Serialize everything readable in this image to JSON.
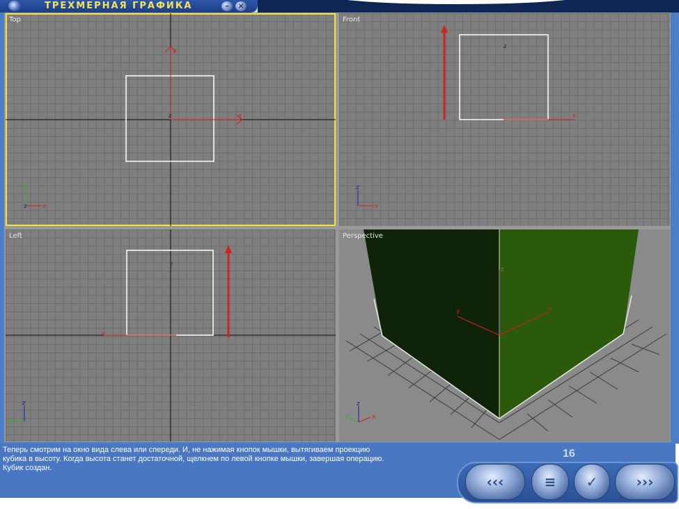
{
  "window": {
    "title": "ТРЕХМЕРНАЯ ГРАФИКА",
    "minimize_symbol": "–",
    "close_symbol": "×"
  },
  "viewports": {
    "top": {
      "label": "Top"
    },
    "front": {
      "label": "Front"
    },
    "left": {
      "label": "Left"
    },
    "perspective": {
      "label": "Perspective"
    }
  },
  "axes": {
    "x": "x",
    "y": "y",
    "z": "z"
  },
  "info": {
    "lines": [
      "Теперь смотрим на окно вида слева или спереди. И, не нажимая кнопок мышки, вытягиваем проекцию",
      "кубика в высоту. Когда высота станет достаточной, щелкнем по левой кнопке мышки, завершая операцию.",
      "Кубик создан."
    ]
  },
  "page": {
    "number": "16"
  },
  "nav": {
    "back": "‹‹‹",
    "menu": "≡",
    "check": "✓",
    "forward": "›››"
  },
  "colors": {
    "active_border": "#f5e33a",
    "axis_red": "#d42020",
    "cube_front": "#0f2309",
    "cube_side": "#2a5a0a",
    "frame_blue": "#4c7dc8"
  }
}
